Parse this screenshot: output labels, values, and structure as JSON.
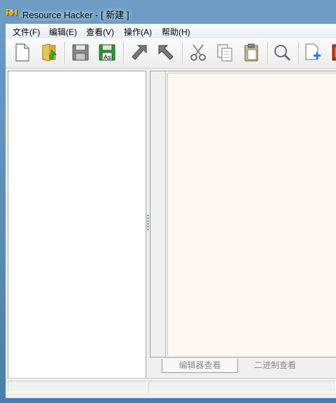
{
  "window": {
    "title": "Resource Hacker - [ 新建 ]",
    "app_icon_text": "RH"
  },
  "menubar": {
    "items": [
      {
        "label": "文件(F)"
      },
      {
        "label": "编辑(E)"
      },
      {
        "label": "查看(V)"
      },
      {
        "label": "操作(A)"
      },
      {
        "label": "帮助(H)"
      }
    ]
  },
  "toolbar": {
    "buttons": [
      {
        "icon": "new-file-icon"
      },
      {
        "icon": "open-folder-icon"
      },
      {
        "icon": "save-icon"
      },
      {
        "icon": "save-as-icon",
        "text": "As"
      },
      {
        "icon": "compile-arrow-icon"
      },
      {
        "icon": "forward-arrow-icon"
      },
      {
        "icon": "cut-icon"
      },
      {
        "icon": "copy-icon"
      },
      {
        "icon": "paste-icon"
      },
      {
        "icon": "search-icon"
      },
      {
        "icon": "add-resource-icon"
      },
      {
        "icon": "dialog-merger-icon"
      }
    ]
  },
  "tabs": [
    {
      "label": "编辑器查看",
      "active": true
    },
    {
      "label": "二进制查看",
      "active": false
    }
  ],
  "colors": {
    "editor_bg": "#fff8f0",
    "title_bar": "#4a7eb0"
  }
}
